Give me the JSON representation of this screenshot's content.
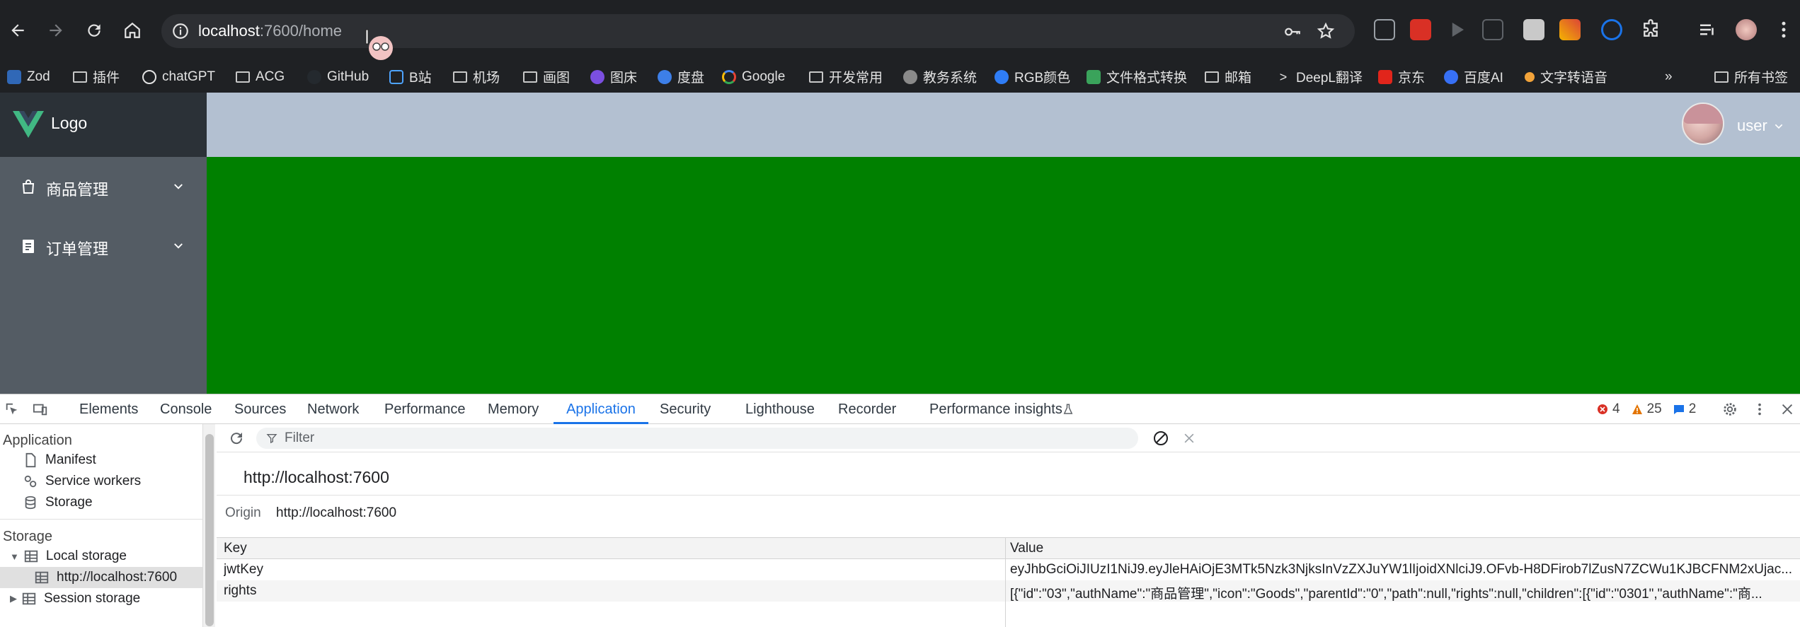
{
  "browser": {
    "url_host": "localhost",
    "url_rest": ":7600/home",
    "bookmarks": [
      {
        "label": "Zod",
        "icon": "zod-icon"
      },
      {
        "label": "插件",
        "icon": "folder-icon"
      },
      {
        "label": "chatGPT",
        "icon": "openai-icon"
      },
      {
        "label": "ACG",
        "icon": "folder-icon"
      },
      {
        "label": "GitHub",
        "icon": "github-icon"
      },
      {
        "label": "B站",
        "icon": "bilibili-icon"
      },
      {
        "label": "机场",
        "icon": "folder-icon"
      },
      {
        "label": "画图",
        "icon": "folder-icon"
      },
      {
        "label": "图床",
        "icon": "picture-host-icon"
      },
      {
        "label": "度盘",
        "icon": "baidu-pan-icon"
      },
      {
        "label": "Google",
        "icon": "google-icon"
      },
      {
        "label": "开发常用",
        "icon": "folder-icon"
      },
      {
        "label": "教务系统",
        "icon": "globe-icon"
      },
      {
        "label": "RGB颜色",
        "icon": "rgb-icon"
      },
      {
        "label": "文件格式转换",
        "icon": "converter-icon"
      },
      {
        "label": "邮箱",
        "icon": "folder-icon"
      },
      {
        "label": "DeepL翻译",
        "icon": "deepl-icon"
      },
      {
        "label": "京东",
        "icon": "jd-icon"
      },
      {
        "label": "百度AI",
        "icon": "baidu-ai-icon"
      },
      {
        "label": "文字转语音",
        "icon": "tts-icon"
      }
    ],
    "all_bookmarks_label": "所有书签"
  },
  "app": {
    "logo_text": "Logo",
    "menu": [
      {
        "label": "商品管理",
        "icon": "bag-icon"
      },
      {
        "label": "订单管理",
        "icon": "document-icon"
      }
    ],
    "username": "user",
    "colors": {
      "sidebar": "#545c64",
      "logo_bar": "#2b3137",
      "header": "#b3c0d1",
      "main": "#008000",
      "vue_green": "#41b883"
    }
  },
  "devtools": {
    "tabs": [
      "Elements",
      "Console",
      "Sources",
      "Network",
      "Performance",
      "Memory",
      "Application",
      "Security",
      "Lighthouse",
      "Recorder",
      "Performance insights"
    ],
    "active_tab": "Application",
    "errors": "4",
    "warnings": "25",
    "messages": "2",
    "sidebar": {
      "section_application": "Application",
      "application_items": [
        "Manifest",
        "Service workers",
        "Storage"
      ],
      "section_storage": "Storage",
      "local_storage": "Local storage",
      "local_storage_origin": "http://localhost:7600",
      "session_storage": "Session storage"
    },
    "filter_placeholder": "Filter",
    "origin_title": "http://localhost:7600",
    "origin_label": "Origin",
    "origin_value": "http://localhost:7600",
    "table": {
      "col_key": "Key",
      "col_value": "Value",
      "rows": [
        {
          "key": "jwtKey",
          "value": "eyJhbGciOiJIUzI1NiJ9.eyJleHAiOjE3MTk5Nzk3NjksInVzZXJuYW1lIjoidXNlciJ9.OFvb-H8DFirob7lZusN7ZCWu1KJBCFNM2xUjac..."
        },
        {
          "key": "rights",
          "value": "[{\"id\":\"03\",\"authName\":\"商品管理\",\"icon\":\"Goods\",\"parentId\":\"0\",\"path\":null,\"rights\":null,\"children\":[{\"id\":\"0301\",\"authName\":\"商..."
        }
      ]
    }
  }
}
